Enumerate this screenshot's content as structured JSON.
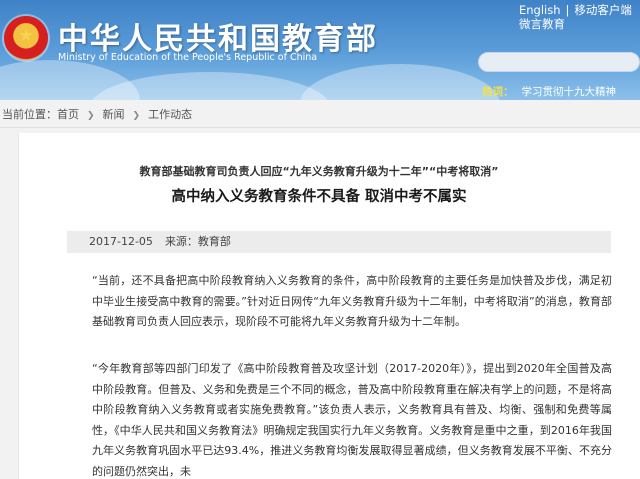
{
  "header": {
    "site_title": "中华人民共和国教育部",
    "site_subtitle": "Ministry of Education of the People's Republic of China",
    "top_links": [
      "English",
      "移动客户端"
    ],
    "wechat": "微言教育",
    "hot_label": "热词：",
    "hot_text": "学习贯彻十九大精神"
  },
  "breadcrumb": {
    "prefix": "当前位置：",
    "items": [
      "首页",
      "新闻",
      "工作动态"
    ]
  },
  "article": {
    "kicker": "教育部基础教育司负责人回应“九年义务教育升级为十二年”“中考将取消”",
    "headline": "高中纳入义务教育条件不具备 取消中考不属实",
    "date": "2017-12-05",
    "source": "来源：教育部",
    "paragraphs": [
      "“当前，还不具备把高中阶段教育纳入义务教育的条件，高中阶段教育的主要任务是加快普及步伐，满足初中毕业生接受高中教育的需要。”针对近日网传“九年义务教育升级为十二年制，中考将取消”的消息，教育部基础教育司负责人回应表示，现阶段不可能将九年义务教育升级为十二年制。",
      "“今年教育部等四部门印发了《高中阶段教育普及攻坚计划（2017-2020年）》，提出到2020年全国普及高中阶段教育。但普及、义务和免费是三个不同的概念，普及高中阶段教育重在解决有学上的问题，不是将高中阶段教育纳入义务教育或者实施免费教育。”该负责人表示，义务教育具有普及、均衡、强制和免费等属性，《中华人民共和国义务教育法》明确规定我国实行九年义务教育。义务教育是重中之重，到2016年我国九年义务教育巩固水平已达93.4%，推进义务教育均衡发展取得显著成绩，但义务教育发展不平衡、不充分的问题仍然突出，未"
    ]
  }
}
